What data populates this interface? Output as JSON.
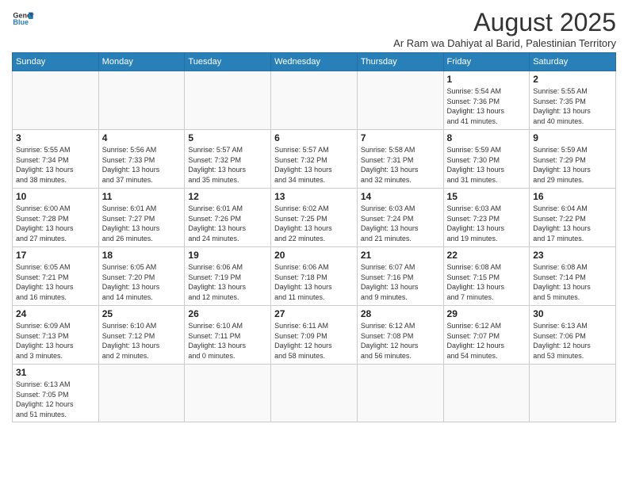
{
  "logo": {
    "line1": "General",
    "line2": "Blue"
  },
  "title": "August 2025",
  "subtitle": "Ar Ram wa Dahiyat al Barid, Palestinian Territory",
  "weekdays": [
    "Sunday",
    "Monday",
    "Tuesday",
    "Wednesday",
    "Thursday",
    "Friday",
    "Saturday"
  ],
  "weeks": [
    [
      {
        "day": "",
        "info": ""
      },
      {
        "day": "",
        "info": ""
      },
      {
        "day": "",
        "info": ""
      },
      {
        "day": "",
        "info": ""
      },
      {
        "day": "",
        "info": ""
      },
      {
        "day": "1",
        "info": "Sunrise: 5:54 AM\nSunset: 7:36 PM\nDaylight: 13 hours\nand 41 minutes."
      },
      {
        "day": "2",
        "info": "Sunrise: 5:55 AM\nSunset: 7:35 PM\nDaylight: 13 hours\nand 40 minutes."
      }
    ],
    [
      {
        "day": "3",
        "info": "Sunrise: 5:55 AM\nSunset: 7:34 PM\nDaylight: 13 hours\nand 38 minutes."
      },
      {
        "day": "4",
        "info": "Sunrise: 5:56 AM\nSunset: 7:33 PM\nDaylight: 13 hours\nand 37 minutes."
      },
      {
        "day": "5",
        "info": "Sunrise: 5:57 AM\nSunset: 7:32 PM\nDaylight: 13 hours\nand 35 minutes."
      },
      {
        "day": "6",
        "info": "Sunrise: 5:57 AM\nSunset: 7:32 PM\nDaylight: 13 hours\nand 34 minutes."
      },
      {
        "day": "7",
        "info": "Sunrise: 5:58 AM\nSunset: 7:31 PM\nDaylight: 13 hours\nand 32 minutes."
      },
      {
        "day": "8",
        "info": "Sunrise: 5:59 AM\nSunset: 7:30 PM\nDaylight: 13 hours\nand 31 minutes."
      },
      {
        "day": "9",
        "info": "Sunrise: 5:59 AM\nSunset: 7:29 PM\nDaylight: 13 hours\nand 29 minutes."
      }
    ],
    [
      {
        "day": "10",
        "info": "Sunrise: 6:00 AM\nSunset: 7:28 PM\nDaylight: 13 hours\nand 27 minutes."
      },
      {
        "day": "11",
        "info": "Sunrise: 6:01 AM\nSunset: 7:27 PM\nDaylight: 13 hours\nand 26 minutes."
      },
      {
        "day": "12",
        "info": "Sunrise: 6:01 AM\nSunset: 7:26 PM\nDaylight: 13 hours\nand 24 minutes."
      },
      {
        "day": "13",
        "info": "Sunrise: 6:02 AM\nSunset: 7:25 PM\nDaylight: 13 hours\nand 22 minutes."
      },
      {
        "day": "14",
        "info": "Sunrise: 6:03 AM\nSunset: 7:24 PM\nDaylight: 13 hours\nand 21 minutes."
      },
      {
        "day": "15",
        "info": "Sunrise: 6:03 AM\nSunset: 7:23 PM\nDaylight: 13 hours\nand 19 minutes."
      },
      {
        "day": "16",
        "info": "Sunrise: 6:04 AM\nSunset: 7:22 PM\nDaylight: 13 hours\nand 17 minutes."
      }
    ],
    [
      {
        "day": "17",
        "info": "Sunrise: 6:05 AM\nSunset: 7:21 PM\nDaylight: 13 hours\nand 16 minutes."
      },
      {
        "day": "18",
        "info": "Sunrise: 6:05 AM\nSunset: 7:20 PM\nDaylight: 13 hours\nand 14 minutes."
      },
      {
        "day": "19",
        "info": "Sunrise: 6:06 AM\nSunset: 7:19 PM\nDaylight: 13 hours\nand 12 minutes."
      },
      {
        "day": "20",
        "info": "Sunrise: 6:06 AM\nSunset: 7:18 PM\nDaylight: 13 hours\nand 11 minutes."
      },
      {
        "day": "21",
        "info": "Sunrise: 6:07 AM\nSunset: 7:16 PM\nDaylight: 13 hours\nand 9 minutes."
      },
      {
        "day": "22",
        "info": "Sunrise: 6:08 AM\nSunset: 7:15 PM\nDaylight: 13 hours\nand 7 minutes."
      },
      {
        "day": "23",
        "info": "Sunrise: 6:08 AM\nSunset: 7:14 PM\nDaylight: 13 hours\nand 5 minutes."
      }
    ],
    [
      {
        "day": "24",
        "info": "Sunrise: 6:09 AM\nSunset: 7:13 PM\nDaylight: 13 hours\nand 3 minutes."
      },
      {
        "day": "25",
        "info": "Sunrise: 6:10 AM\nSunset: 7:12 PM\nDaylight: 13 hours\nand 2 minutes."
      },
      {
        "day": "26",
        "info": "Sunrise: 6:10 AM\nSunset: 7:11 PM\nDaylight: 13 hours\nand 0 minutes."
      },
      {
        "day": "27",
        "info": "Sunrise: 6:11 AM\nSunset: 7:09 PM\nDaylight: 12 hours\nand 58 minutes."
      },
      {
        "day": "28",
        "info": "Sunrise: 6:12 AM\nSunset: 7:08 PM\nDaylight: 12 hours\nand 56 minutes."
      },
      {
        "day": "29",
        "info": "Sunrise: 6:12 AM\nSunset: 7:07 PM\nDaylight: 12 hours\nand 54 minutes."
      },
      {
        "day": "30",
        "info": "Sunrise: 6:13 AM\nSunset: 7:06 PM\nDaylight: 12 hours\nand 53 minutes."
      }
    ],
    [
      {
        "day": "31",
        "info": "Sunrise: 6:13 AM\nSunset: 7:05 PM\nDaylight: 12 hours\nand 51 minutes."
      },
      {
        "day": "",
        "info": ""
      },
      {
        "day": "",
        "info": ""
      },
      {
        "day": "",
        "info": ""
      },
      {
        "day": "",
        "info": ""
      },
      {
        "day": "",
        "info": ""
      },
      {
        "day": "",
        "info": ""
      }
    ]
  ]
}
